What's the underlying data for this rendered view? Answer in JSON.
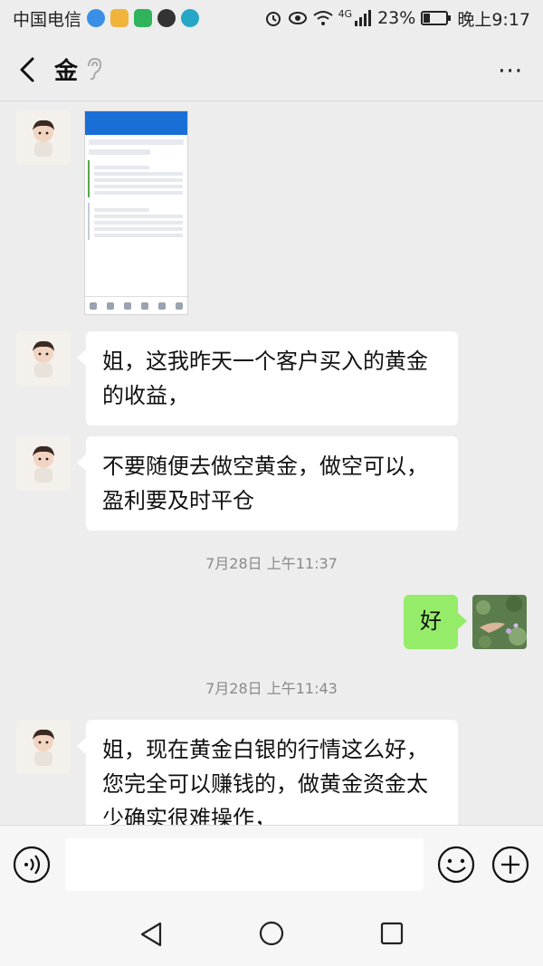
{
  "status": {
    "carrier": "中国电信",
    "network": "4G",
    "battery": "23%",
    "time": "晚上9:17"
  },
  "header": {
    "title": "金",
    "more_label": "···"
  },
  "messages": [
    {
      "side": "left",
      "type": "image",
      "description": "screenshot-thumbnail"
    },
    {
      "side": "left",
      "type": "text",
      "lines": [
        "姐，这我昨天一个客户买入的黄金",
        "的收益，"
      ]
    },
    {
      "side": "left",
      "type": "text",
      "lines": [
        "不要随便去做空黄金，做空可以，",
        "盈利要及时平仓"
      ]
    },
    {
      "type": "time",
      "text": "7月28日 上午11:37"
    },
    {
      "side": "right",
      "type": "text",
      "lines": [
        "好"
      ]
    },
    {
      "type": "time",
      "text": "7月28日 上午11:43"
    },
    {
      "side": "left",
      "type": "text",
      "lines": [
        "姐，现在黄金白银的行情这么好，",
        "您完全可以赚钱的，做黄金资金太",
        "少确实很难操作，"
      ]
    }
  ],
  "input": {
    "placeholder": ""
  },
  "colors": {
    "background": "#ededed",
    "bubble_left": "#ffffff",
    "bubble_right": "#95ec69"
  },
  "icons": [
    "back-arrow-icon",
    "ear-icon",
    "more-icon",
    "voice-icon",
    "emoji-icon",
    "plus-icon",
    "nav-back-icon",
    "nav-home-icon",
    "nav-recent-icon"
  ]
}
